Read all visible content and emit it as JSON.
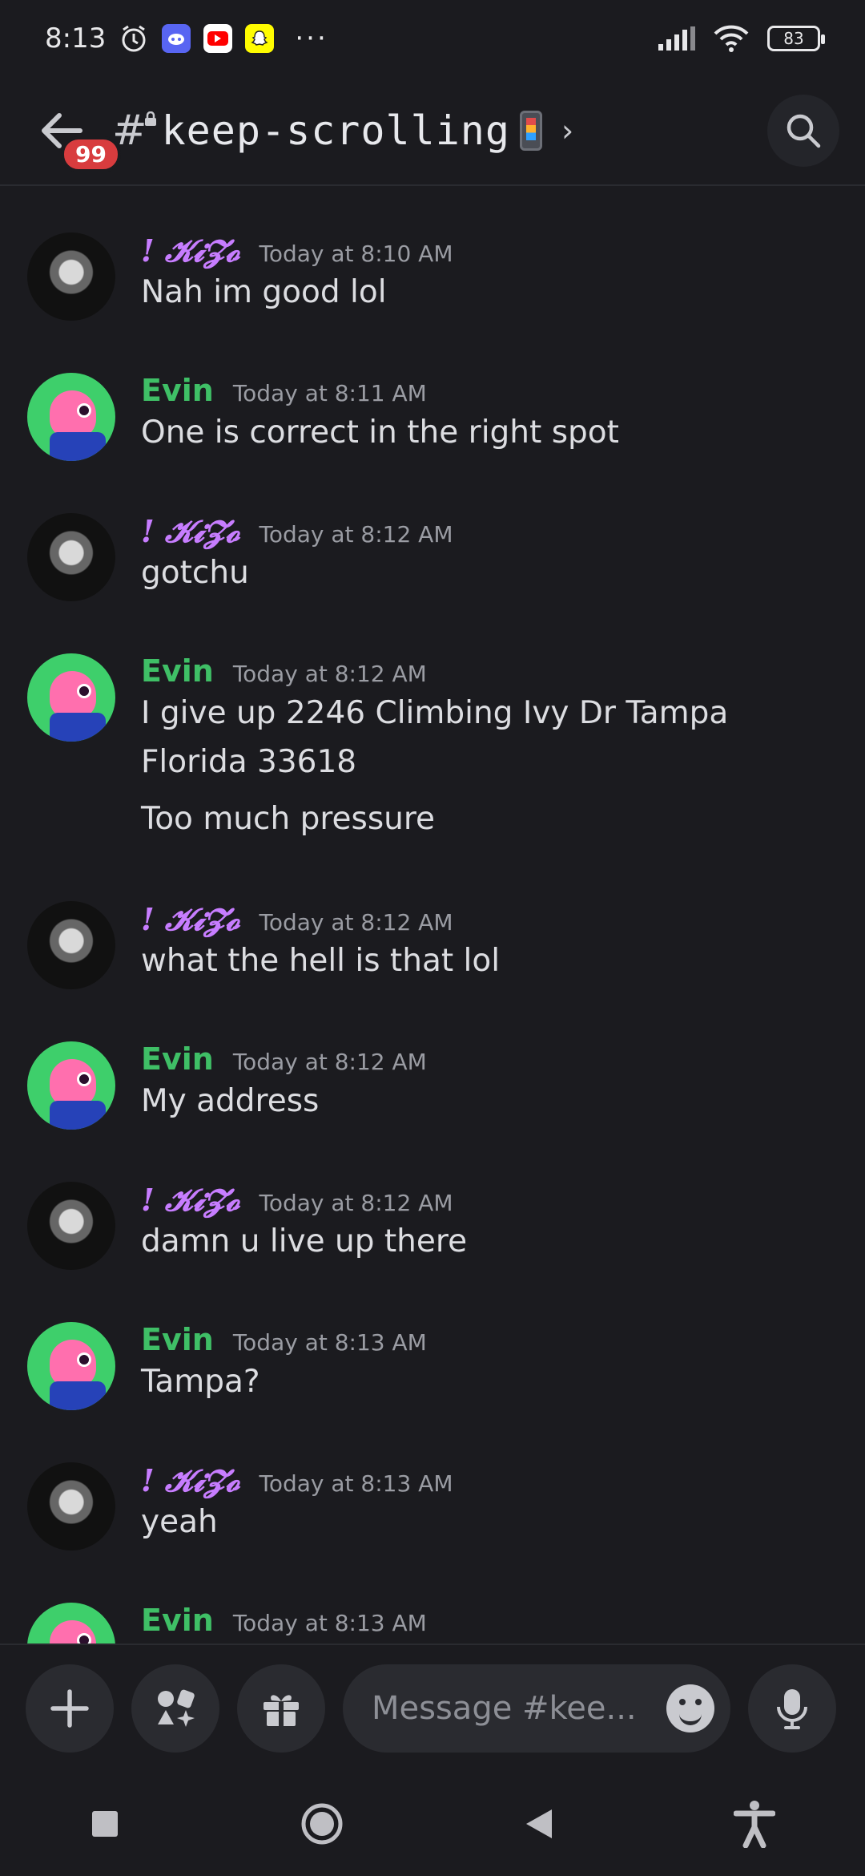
{
  "status_bar": {
    "time": "8:13",
    "more": "···",
    "battery": "83",
    "icons": [
      "alarm-icon",
      "discord-icon",
      "youtube-icon",
      "snapchat-icon",
      "signal-icon",
      "wifi-icon"
    ]
  },
  "header": {
    "badge": "99",
    "hash": "#",
    "channel_name": "keep-scrolling",
    "chevron": "›"
  },
  "users": {
    "kizo": "! 𝓚𝓲𝓩𝓸",
    "evin": "Evin"
  },
  "messages": [
    {
      "author": "kizo",
      "time": "Today at 8:10 AM",
      "lines": [
        "Nah im good lol"
      ]
    },
    {
      "author": "evin",
      "time": "Today at 8:11 AM",
      "lines": [
        "One is correct in the right spot"
      ]
    },
    {
      "author": "kizo",
      "time": "Today at 8:12 AM",
      "lines": [
        "gotchu"
      ]
    },
    {
      "author": "evin",
      "time": "Today at 8:12 AM",
      "lines": [
        "I give up 2246 Climbing Ivy Dr Tampa Florida 33618",
        "Too much pressure"
      ]
    },
    {
      "author": "kizo",
      "time": "Today at 8:12 AM",
      "lines": [
        "what the hell is that lol"
      ]
    },
    {
      "author": "evin",
      "time": "Today at 8:12 AM",
      "lines": [
        "My address"
      ]
    },
    {
      "author": "kizo",
      "time": "Today at 8:12 AM",
      "lines": [
        "damn u live up there"
      ]
    },
    {
      "author": "evin",
      "time": "Today at 8:13 AM",
      "lines": [
        "Tampa?"
      ]
    },
    {
      "author": "kizo",
      "time": "Today at 8:13 AM",
      "lines": [
        "yeah"
      ]
    },
    {
      "author": "evin",
      "time": "Today at 8:13 AM",
      "lines": []
    }
  ],
  "composer": {
    "placeholder": "Message #kee..."
  },
  "colors": {
    "background": "#1b1b1f",
    "kizo_name": "#c77dff",
    "evin_name": "#3fbf66",
    "badge": "#d83c3e"
  }
}
